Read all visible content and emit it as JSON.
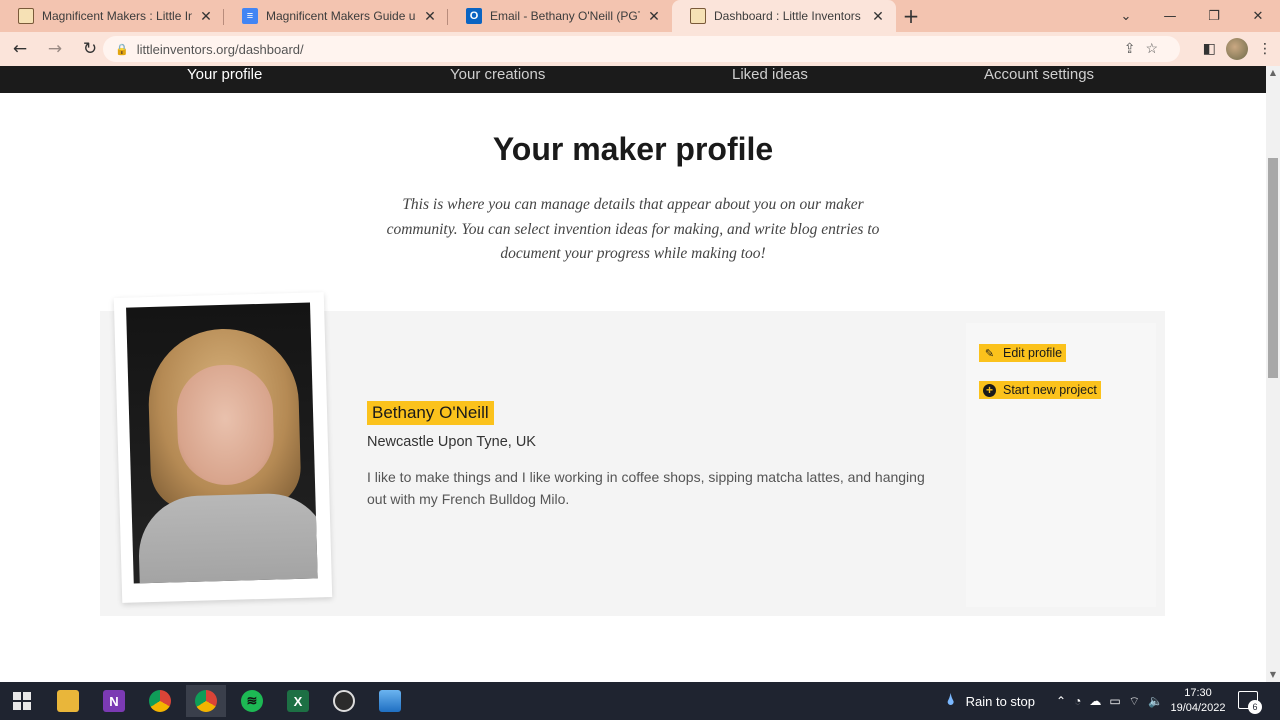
{
  "browser": {
    "tabs": [
      {
        "title": "Magnificent Makers : Little Inven",
        "icon": "book-icon"
      },
      {
        "title": "Magnificent Makers Guide updat",
        "icon": "google-docs-icon"
      },
      {
        "title": "Email - Bethany O'Neill (PGT) - O",
        "icon": "outlook-icon"
      },
      {
        "title": "Dashboard : Little Inventors",
        "icon": "book-icon"
      }
    ],
    "active_tab": 3,
    "url": "littleinventors.org/dashboard/"
  },
  "site_nav": {
    "items": [
      "Your profile",
      "Your creations",
      "Liked ideas",
      "Account settings"
    ],
    "active": "Your profile"
  },
  "page": {
    "heading": "Your maker profile",
    "intro": "This is where you can manage details that appear about you on our maker community. You can select invention ideas for making, and write blog entries to document your progress while making too!"
  },
  "profile": {
    "name": "Bethany O'Neill",
    "location": "Newcastle Upon Tyne, UK",
    "bio": "I like to make things and I like working in coffee shops, sipping matcha lattes, and hanging out with my French Bulldog Milo."
  },
  "actions": {
    "edit_label": "Edit profile",
    "new_project_label": "Start new project"
  },
  "taskbar": {
    "weather": "Rain to stop",
    "time": "17:30",
    "date": "19/04/2022",
    "notifications": "6"
  },
  "colors": {
    "accent": "#fbc21c",
    "nav_bg": "#1b1b1b",
    "tab_strip": "#f3c4b0"
  }
}
